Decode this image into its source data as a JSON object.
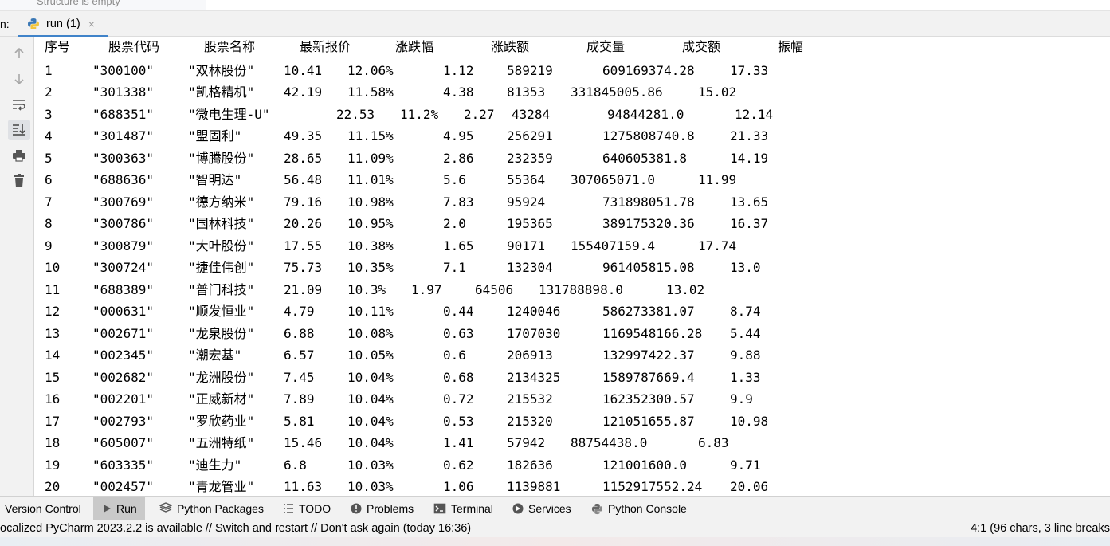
{
  "structure_panel": {
    "empty_text": "Structure is empty"
  },
  "run_window": {
    "prefix_label": "n:",
    "tab": {
      "label": "run (1)",
      "close": "×"
    }
  },
  "left_toolbar": {
    "buttons": [
      {
        "name": "scroll-up",
        "icon": "arrow-up-icon"
      },
      {
        "name": "scroll-down",
        "icon": "arrow-down-icon"
      },
      {
        "name": "soft-wrap",
        "icon": "soft-wrap-icon"
      },
      {
        "name": "scroll-to-end",
        "icon": "scroll-to-end-icon"
      },
      {
        "name": "print",
        "icon": "print-icon"
      },
      {
        "name": "clear-all",
        "icon": "trash-icon"
      }
    ]
  },
  "console": {
    "header": [
      "序号",
      "股票代码",
      "股票名称",
      "最新报价",
      "涨跌幅",
      "涨跌额",
      "成交量",
      "成交额",
      "振幅"
    ],
    "rows": [
      [
        "1",
        "\"300100\"",
        "\"双林股份\"",
        "10.41",
        "12.06%",
        "1.12",
        "589219",
        "609169374.28",
        "17.33"
      ],
      [
        "2",
        "\"301338\"",
        "\"凯格精机\"",
        "42.19",
        "11.58%",
        "4.38",
        "81353",
        "331845005.86",
        "15.02"
      ],
      [
        "3",
        "\"688351\"",
        "\"微电生理-U\"",
        "22.53",
        "11.2%",
        "2.27",
        "43284",
        "94844281.0",
        "12.14"
      ],
      [
        "4",
        "\"301487\"",
        "\"盟固利\"",
        "49.35",
        "11.15%",
        "4.95",
        "256291",
        "1275808740.8",
        "21.33"
      ],
      [
        "5",
        "\"300363\"",
        "\"博腾股份\"",
        "28.65",
        "11.09%",
        "2.86",
        "232359",
        "640605381.8",
        "14.19"
      ],
      [
        "6",
        "\"688636\"",
        "\"智明达\"",
        "56.48",
        "11.01%",
        "5.6",
        "55364",
        "307065071.0",
        "11.99"
      ],
      [
        "7",
        "\"300769\"",
        "\"德方纳米\"",
        "79.16",
        "10.98%",
        "7.83",
        "95924",
        "731898051.78",
        "13.65"
      ],
      [
        "8",
        "\"300786\"",
        "\"国林科技\"",
        "20.26",
        "10.95%",
        "2.0",
        "195365",
        "389175320.36",
        "16.37"
      ],
      [
        "9",
        "\"300879\"",
        "\"大叶股份\"",
        "17.55",
        "10.38%",
        "1.65",
        "90171",
        "155407159.4",
        "17.74"
      ],
      [
        "10",
        "\"300724\"",
        "\"捷佳伟创\"",
        "75.73",
        "10.35%",
        "7.1",
        "132304",
        "961405815.08",
        "13.0"
      ],
      [
        "11",
        "\"688389\"",
        "\"普门科技\"",
        "21.09",
        "10.3%",
        "1.97",
        "64506",
        "131788898.0",
        "13.02"
      ],
      [
        "12",
        "\"000631\"",
        "\"顺发恒业\"",
        "4.79",
        "10.11%",
        "0.44",
        "1240046",
        "586273381.07",
        "8.74"
      ],
      [
        "13",
        "\"002671\"",
        "\"龙泉股份\"",
        "6.88",
        "10.08%",
        "0.63",
        "1707030",
        "1169548166.28",
        "5.44"
      ],
      [
        "14",
        "\"002345\"",
        "\"潮宏基\"",
        "6.57",
        "10.05%",
        "0.6",
        "206913",
        "132997422.37",
        "9.88"
      ],
      [
        "15",
        "\"002682\"",
        "\"龙洲股份\"",
        "7.45",
        "10.04%",
        "0.68",
        "2134325",
        "1589787669.4",
        "1.33"
      ],
      [
        "16",
        "\"002201\"",
        "\"正威新材\"",
        "7.89",
        "10.04%",
        "0.72",
        "215532",
        "162352300.57",
        "9.9"
      ],
      [
        "17",
        "\"002793\"",
        "\"罗欣药业\"",
        "5.81",
        "10.04%",
        "0.53",
        "215320",
        "121051655.87",
        "10.98"
      ],
      [
        "18",
        "\"605007\"",
        "\"五洲特纸\"",
        "15.46",
        "10.04%",
        "1.41",
        "57942",
        "88754438.0",
        "6.83"
      ],
      [
        "19",
        "\"603335\"",
        "\"迪生力\"",
        "6.8",
        "10.03%",
        "0.62",
        "182636",
        "121001600.0",
        "9.71"
      ],
      [
        "20",
        "\"002457\"",
        "\"青龙管业\"",
        "11.63",
        "10.03%",
        "1.06",
        "1139881",
        "1152917552.24",
        "20.06"
      ]
    ]
  },
  "bottom_tools": [
    {
      "label": "Version Control",
      "icon": ""
    },
    {
      "label": "Run",
      "icon": "run-icon",
      "active": true
    },
    {
      "label": "Python Packages",
      "icon": "packages-icon"
    },
    {
      "label": "TODO",
      "icon": "todo-icon"
    },
    {
      "label": "Problems",
      "icon": "problems-icon"
    },
    {
      "label": "Terminal",
      "icon": "terminal-icon"
    },
    {
      "label": "Services",
      "icon": "services-icon"
    },
    {
      "label": "Python Console",
      "icon": "python-console-icon"
    }
  ],
  "status_bar": {
    "message": "ocalized PyCharm 2023.2.2 is available // Switch and restart // Don't ask again (today 16:36)",
    "position": "4:1 (96 chars, 3 line breaks"
  },
  "colors": {
    "accent": "#4083c9",
    "toolbar_bg": "#f2f2f2",
    "active_tool_bg": "#c9c9c9"
  }
}
